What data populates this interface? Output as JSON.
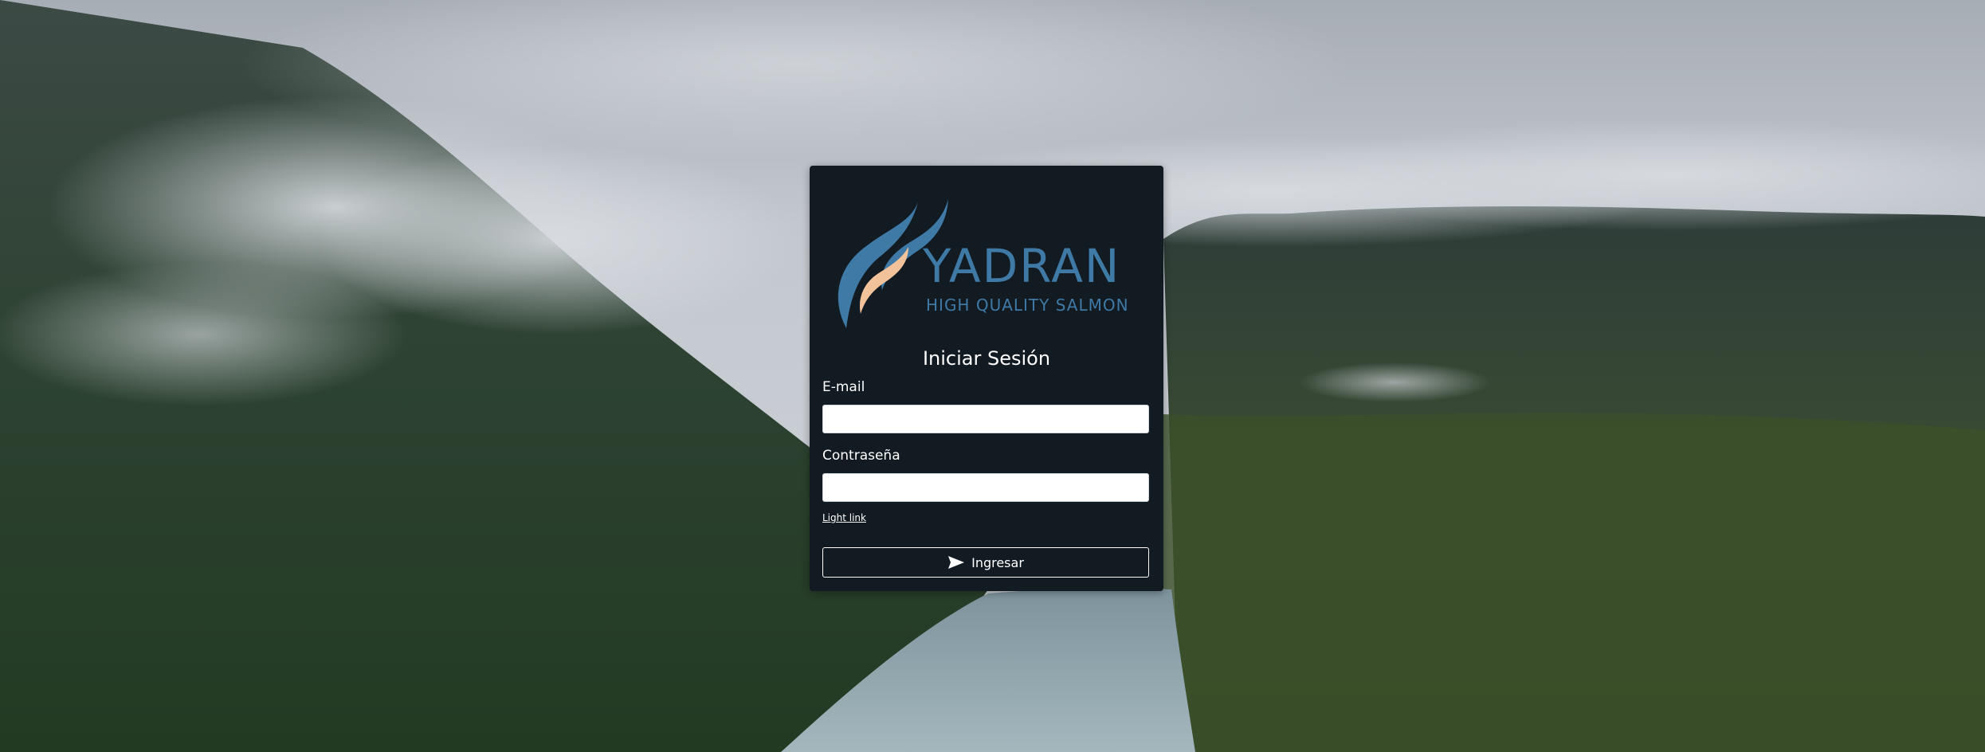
{
  "brand": {
    "name": "YADRAN",
    "tagline": "HIGH QUALITY SALMON",
    "logo_icon": "salmon-wave-logo",
    "color_primary": "#3f79a6",
    "color_accent": "#f2c29b"
  },
  "login": {
    "title": "Iniciar Sesión",
    "email_label": "E-mail",
    "email_value": "",
    "password_label": "Contraseña",
    "password_value": "",
    "link_text": "Light link",
    "submit_label": "Ingresar",
    "submit_icon": "send-icon"
  },
  "background": {
    "description_icon": "mountain-landscape",
    "card_color": "#121b22"
  }
}
